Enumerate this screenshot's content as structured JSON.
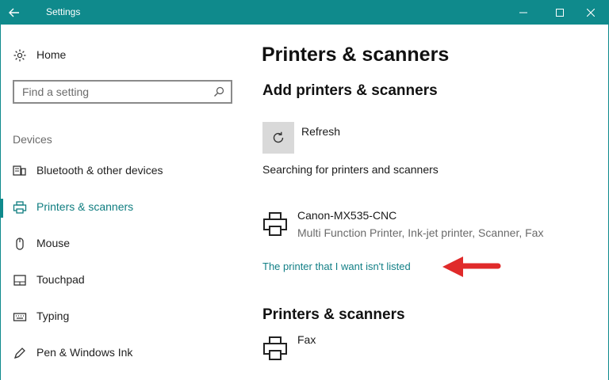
{
  "window": {
    "title": "Settings"
  },
  "sidebar": {
    "home": "Home",
    "search_placeholder": "Find a setting",
    "section": "Devices",
    "items": [
      {
        "label": "Bluetooth & other devices",
        "icon": "bluetooth-devices-icon"
      },
      {
        "label": "Printers & scanners",
        "icon": "printer-icon"
      },
      {
        "label": "Mouse",
        "icon": "mouse-icon"
      },
      {
        "label": "Touchpad",
        "icon": "touchpad-icon"
      },
      {
        "label": "Typing",
        "icon": "keyboard-icon"
      },
      {
        "label": "Pen & Windows Ink",
        "icon": "pen-icon"
      }
    ],
    "selected_index": 1
  },
  "main": {
    "title": "Printers & scanners",
    "add_heading": "Add printers & scanners",
    "refresh_label": "Refresh",
    "searching_text": "Searching for printers and scanners",
    "found_printer": {
      "name": "Canon-MX535-CNC",
      "description": "Multi Function Printer, Ink-jet printer, Scanner, Fax"
    },
    "not_listed_link": "The printer that I want isn't listed",
    "list_heading": "Printers & scanners",
    "installed": [
      {
        "name": "Fax"
      }
    ]
  },
  "colors": {
    "accent": "#0f8a8c",
    "link": "#127f86",
    "arrow": "#e02a2a"
  }
}
